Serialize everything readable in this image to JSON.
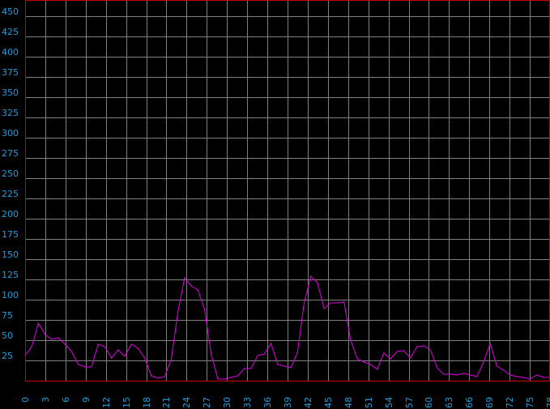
{
  "chart_data": {
    "type": "line",
    "title": "",
    "xlabel": "",
    "ylabel": "",
    "xlim": [
      0,
      78
    ],
    "ylim": [
      0,
      470
    ],
    "grid": true,
    "x_ticks": [
      0,
      3,
      6,
      9,
      12,
      15,
      18,
      21,
      24,
      27,
      30,
      33,
      36,
      39,
      42,
      45,
      48,
      51,
      54,
      57,
      60,
      63,
      66,
      69,
      72,
      75,
      78
    ],
    "y_ticks": [
      25,
      50,
      75,
      100,
      125,
      150,
      175,
      200,
      225,
      250,
      275,
      300,
      325,
      350,
      375,
      400,
      425,
      450
    ],
    "colors": {
      "background": "#000000",
      "grid": "#808080",
      "frame": "#cc0000",
      "tick_label": "#1f9fe0",
      "series": "#e000e0",
      "baseline": "#00cc00"
    },
    "series": [
      {
        "values": [
          31,
          42,
          71,
          57,
          51,
          53,
          45,
          36,
          20,
          17,
          17,
          45,
          42,
          28,
          38,
          30,
          45,
          40,
          28,
          6,
          3,
          5,
          27,
          85,
          127,
          117,
          112,
          88,
          33,
          2,
          2,
          4,
          6,
          15,
          15,
          31,
          33,
          46,
          20,
          18,
          16,
          35,
          96,
          129,
          121,
          89,
          96,
          96,
          97,
          50,
          27,
          23,
          20,
          14,
          34,
          27,
          36,
          37,
          28,
          42,
          43,
          38,
          16,
          8,
          8,
          7,
          9,
          7,
          5,
          23,
          46,
          18,
          13,
          7,
          5,
          4,
          2,
          7,
          4,
          4
        ]
      }
    ],
    "baseline_value": 0
  }
}
